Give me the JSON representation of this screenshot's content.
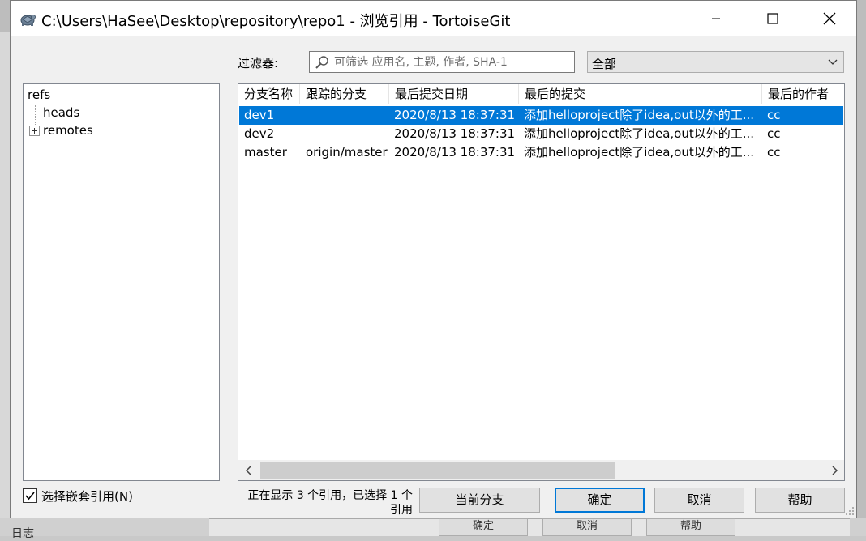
{
  "background": {
    "bottom_label": "日志",
    "buttons": [
      "确定",
      "取消",
      "帮助"
    ]
  },
  "window": {
    "title": "C:\\Users\\HaSee\\Desktop\\repository\\repo1 - 浏览引用 - TortoiseGit",
    "icon": "tortoisegit-icon",
    "controls": {
      "minimize": "minimize-icon",
      "maximize": "maximize-icon",
      "close": "close-icon"
    }
  },
  "filter": {
    "label": "过滤器:",
    "placeholder": "可筛选 应用名, 主题, 作者, SHA-1",
    "scope": "全部"
  },
  "tree": {
    "root": "refs",
    "children": [
      {
        "label": "heads",
        "selected": false
      },
      {
        "label": "remotes",
        "collapsed": true
      }
    ]
  },
  "list": {
    "columns": [
      "分支名称",
      "跟踪的分支",
      "最后提交日期",
      "最后的提交",
      "最后的作者"
    ],
    "rows": [
      {
        "name": "dev1",
        "tracking": "",
        "date": "2020/8/13 18:37:31",
        "commit": "添加helloproject除了idea,out以外的工...",
        "author": "cc",
        "selected": true
      },
      {
        "name": "dev2",
        "tracking": "",
        "date": "2020/8/13 18:37:31",
        "commit": "添加helloproject除了idea,out以外的工...",
        "author": "cc",
        "selected": false
      },
      {
        "name": "master",
        "tracking": "origin/master",
        "date": "2020/8/13 18:37:31",
        "commit": "添加helloproject除了idea,out以外的工...",
        "author": "cc",
        "selected": false
      }
    ]
  },
  "footer": {
    "nested_checkbox_label": "选择嵌套引用(N)",
    "nested_checked": true,
    "status_line1": "正在显示 3 个引用，已选择 1 个",
    "status_line2": "引用",
    "buttons": {
      "current_branch": "当前分支",
      "ok": "确定",
      "cancel": "取消",
      "help": "帮助"
    }
  },
  "colors": {
    "selection": "#0078d7",
    "default_button_border": "#0078d7"
  }
}
